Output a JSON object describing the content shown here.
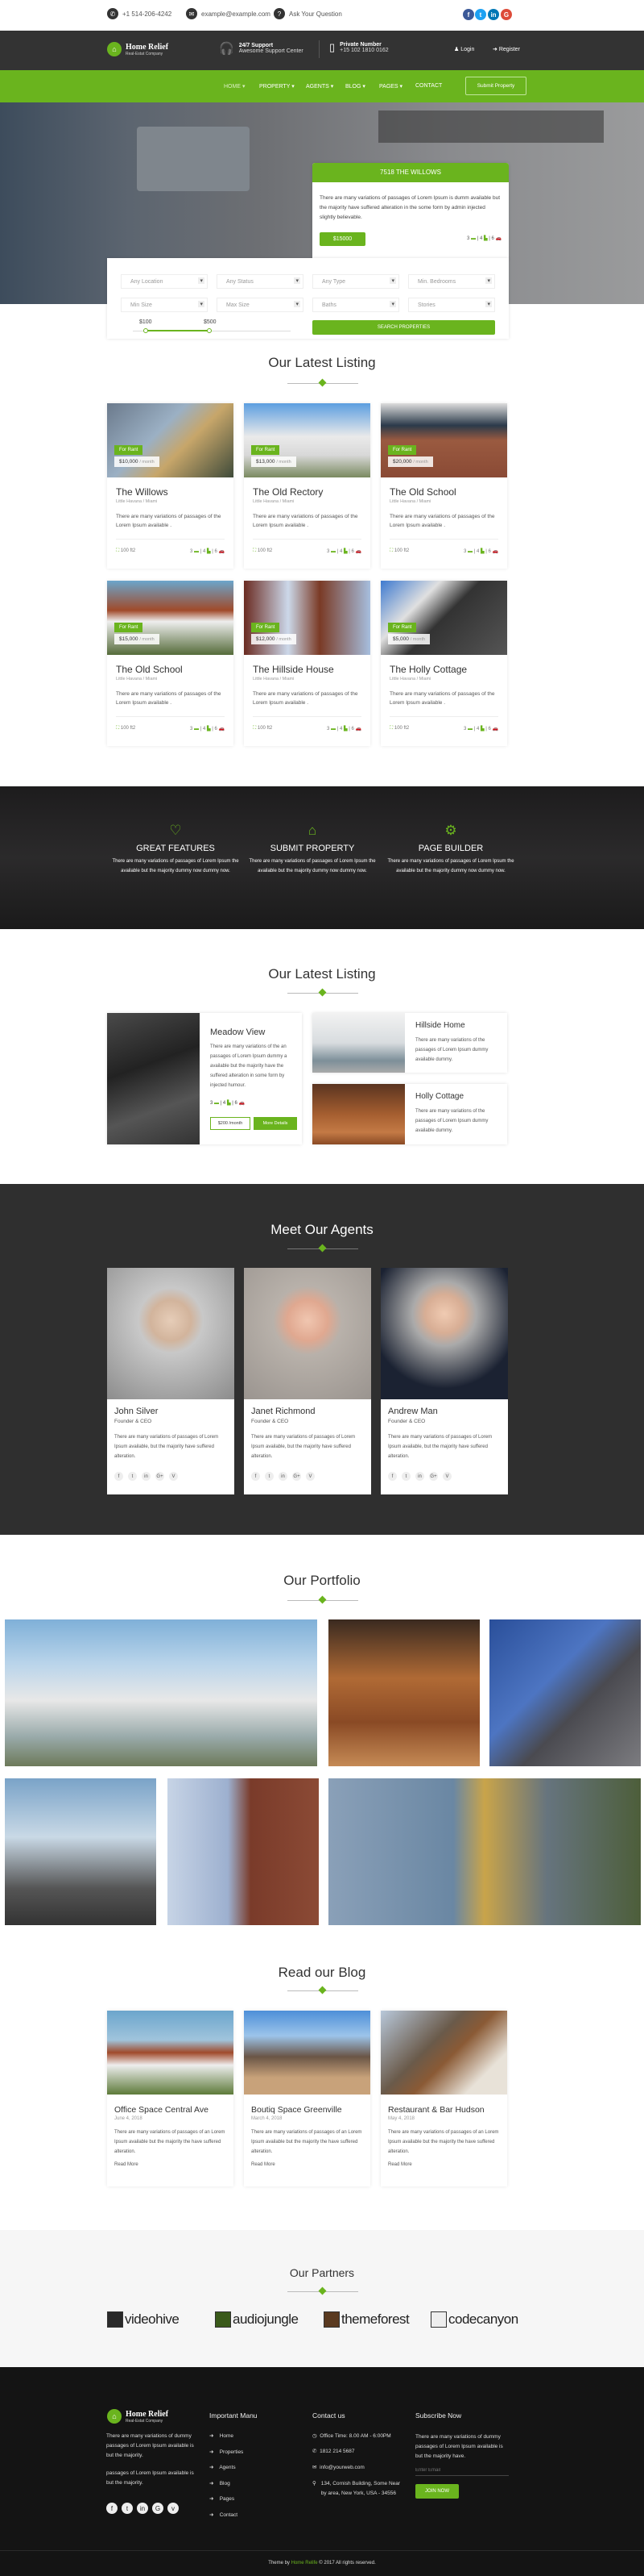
{
  "topbar": {
    "phone": "+1 514-206-4242",
    "email": "example@example.com",
    "question": "Ask Your Question",
    "social": [
      "facebook",
      "twitter",
      "linkedin",
      "google-plus"
    ]
  },
  "header": {
    "logo_title": "Home Relief",
    "logo_sub": "Real-Estat Company",
    "support_title": "24/7 Support",
    "support_sub": "Awesome Support Center",
    "private_title": "Private Number",
    "private_sub": "+15 102 1810 0162",
    "login": "Login",
    "register": "Register"
  },
  "nav": {
    "items": [
      "HOME ▾",
      "PROPERTY ▾",
      "AGENTS ▾",
      "BLOG ▾",
      "PAGES ▾",
      "CONTACT"
    ],
    "submit": "Submit Property"
  },
  "hero": {
    "title": "7518 THE WILLOWS",
    "desc": "There are many variations of passages of Lorem Ipsum is dumm available but the majority have suffered alteration in the some form by admin injected slightly believable.",
    "price": "$15000",
    "beds": "3",
    "baths": "4",
    "garages": "6"
  },
  "search": {
    "fields": [
      "Any Location",
      "Any Status",
      "Any Type",
      "Min. Bedrooms",
      "Min Size",
      "Max Size",
      "Baths",
      "Stories"
    ],
    "range_min": "$100",
    "range_max": "$500",
    "button": "SEARCH PROPERTIES"
  },
  "colors": {
    "accent": "#6ab41e",
    "dark": "#333333"
  },
  "listing": {
    "title": "Our Latest Listing",
    "tag": "For Rant",
    "per": "/ month",
    "location": "Little Havana / Miami",
    "desc": "There are many variations of passages of the Lorem Ipsum available .",
    "area": "100 ft2",
    "beds": "3",
    "baths": "4",
    "garages": "6",
    "items": [
      {
        "name": "The Willows",
        "price": "$10,000"
      },
      {
        "name": "The Old Rectory",
        "price": "$13,000"
      },
      {
        "name": "The Old School",
        "price": "$20,000"
      },
      {
        "name": "The Old School",
        "price": "$15,000"
      },
      {
        "name": "The Hillside House",
        "price": "$12,000"
      },
      {
        "name": "The Holly Cottage",
        "price": "$5,000"
      }
    ]
  },
  "features": [
    {
      "icon": "heart-icon",
      "title": "GREAT FEATURES",
      "desc": "There are many variations of passages of Lorem Ipsum the available but the majority dummy now dummy now."
    },
    {
      "icon": "home-icon",
      "title": "SUBMIT PROPERTY",
      "desc": "There are many variations of passages of Lorem Ipsum the available but the majority dummy now dummy now."
    },
    {
      "icon": "gears-icon",
      "title": "PAGE BUILDER",
      "desc": "There are many variations of passages of Lorem Ipsum the available but the majority dummy now dummy now."
    }
  ],
  "listing2": {
    "title": "Our Latest Listing",
    "main": {
      "name": "Meadow View",
      "desc": "There are many variations of the an passages of Lorem Ipsum dummy a available but the majority have the suffered alteration in some form by injected humour.",
      "beds": "3",
      "baths": "4",
      "garages": "6",
      "price": "$200 /month",
      "button": "More Details"
    },
    "side": [
      {
        "name": "Hillside Home",
        "desc": "There are many variations of the passages of Lorem Ipsum dummy available dummy."
      },
      {
        "name": "Holly Cottage",
        "desc": "There are many variations of the passages of Lorem Ipsum dummy available dummy."
      }
    ]
  },
  "agents": {
    "title": "Meet Our Agents",
    "desc": "There are many variations of passages of Lorem Ipsum available, but the majority have suffered alteration.",
    "social": [
      "f",
      "t",
      "in",
      "G+",
      "V"
    ],
    "items": [
      {
        "name": "John Silver",
        "role": "Founder & CEO"
      },
      {
        "name": "Janet Richmond",
        "role": "Founder & CEO"
      },
      {
        "name": "Andrew Man",
        "role": "Founder & CEO"
      }
    ]
  },
  "portfolio": {
    "title": "Our Portfolio"
  },
  "blog": {
    "title": "Read our Blog",
    "desc": "There are many variations of passages of an Lorem Ipsum available but the majority the have suffered alteration.",
    "more": "Read More",
    "items": [
      {
        "title": "Office Space Central Ave",
        "date": "June 4, 2018"
      },
      {
        "title": "Boutiq Space Greenville",
        "date": "March 4, 2018"
      },
      {
        "title": "Restaurant & Bar Hudson",
        "date": "May 4, 2018"
      }
    ]
  },
  "partners": {
    "title": "Our Partners",
    "items": [
      "videohive",
      "audiojungle",
      "themeforest",
      "codecanyon"
    ]
  },
  "footer": {
    "about1": "There are many variations of dummy passages of Lorem Ipsum available is but the majority.",
    "about2": "passages of Lorem Ipsum available is but the majority.",
    "menu_title": "Important Manu",
    "menu": [
      "Home",
      "Properties",
      "Agents",
      "Blog",
      "Pages",
      "Contact"
    ],
    "contact_title": "Contact us",
    "office": "Office Time: 8.00 AM - 6:00PM",
    "phone": "1812 214 5687",
    "email": "info@yourweb.com",
    "address": "134, Cornish Building, Some Near by area, New York, USA - 34556",
    "sub_title": "Subscribe Now",
    "sub_desc": "There are many variations of dummy passages of Lorem Ipsum available is but the majority have.",
    "email_placeholder": "Enter Email",
    "join": "JOIN NOW",
    "copy_pre": "Theme by",
    "copy_brand": "Home Relife",
    "copy_post": "© 2017 All rights reserved."
  }
}
